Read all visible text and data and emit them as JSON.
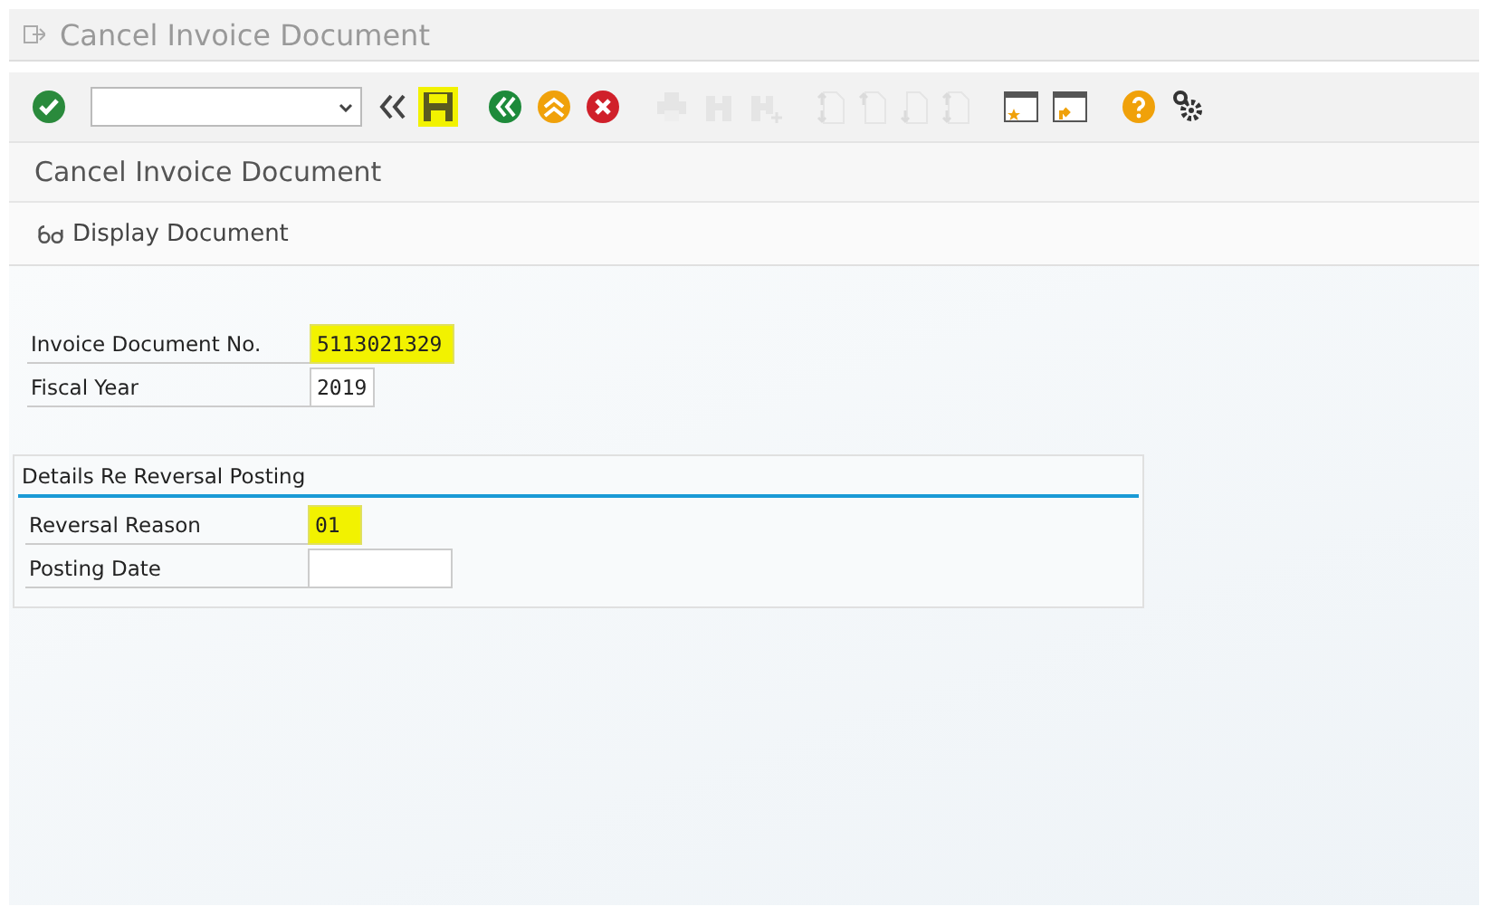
{
  "window": {
    "title": "Cancel Invoice Document"
  },
  "toolbar": {
    "icons": [
      {
        "kind": "check",
        "disabled": false,
        "highlighted": false
      },
      {
        "kind": "collapse",
        "disabled": false,
        "highlighted": false
      },
      {
        "kind": "save",
        "disabled": false,
        "highlighted": true
      },
      {
        "kind": "back",
        "disabled": false,
        "highlighted": false
      },
      {
        "kind": "exit",
        "disabled": false,
        "highlighted": false
      },
      {
        "kind": "cancel",
        "disabled": false,
        "highlighted": false
      },
      {
        "kind": "print",
        "disabled": true,
        "highlighted": false
      },
      {
        "kind": "find",
        "disabled": true,
        "highlighted": false
      },
      {
        "kind": "find-next",
        "disabled": true,
        "highlighted": false
      },
      {
        "kind": "first-page",
        "disabled": true,
        "highlighted": false
      },
      {
        "kind": "prev-page",
        "disabled": true,
        "highlighted": false
      },
      {
        "kind": "next-page",
        "disabled": true,
        "highlighted": false
      },
      {
        "kind": "last-page",
        "disabled": true,
        "highlighted": false
      },
      {
        "kind": "new-window",
        "disabled": false,
        "highlighted": false
      },
      {
        "kind": "shortcut",
        "disabled": false,
        "highlighted": false
      },
      {
        "kind": "help",
        "disabled": false,
        "highlighted": false
      },
      {
        "kind": "settings",
        "disabled": false,
        "highlighted": false
      }
    ]
  },
  "screen_title": "Cancel Invoice Document",
  "app_toolbar": [
    {
      "label": "Display Document"
    }
  ],
  "fields": [
    {
      "label": "Invoice Document No.",
      "value": "5113021329",
      "highlighted": true
    },
    {
      "label": "Fiscal Year",
      "value": "2019",
      "highlighted": false
    }
  ],
  "group": {
    "title": "Details Re Reversal Posting",
    "fields": [
      {
        "label": "Reversal Reason",
        "value": "01",
        "highlighted": true
      },
      {
        "label": "Posting Date",
        "highlighted": false
      }
    ]
  }
}
